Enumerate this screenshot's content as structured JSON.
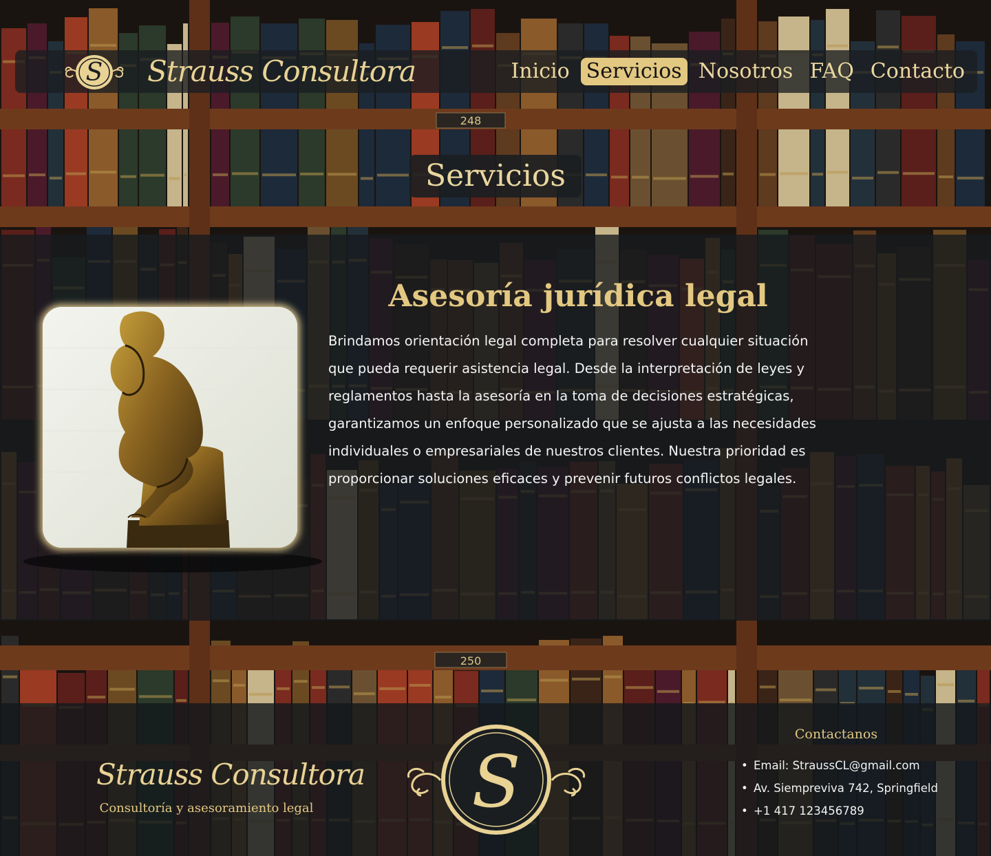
{
  "colors": {
    "accent_gold": "#e3c882",
    "panel_dark": "#1a1e21",
    "text_light": "#f4f4f4"
  },
  "header": {
    "logo_icon": "S-monogram-emblem-icon",
    "logo_letter": "S",
    "brand_name": "Strauss Consultora",
    "nav": [
      {
        "label": "Inicio",
        "active": false
      },
      {
        "label": "Servicios",
        "active": true
      },
      {
        "label": "Nosotros",
        "active": false
      },
      {
        "label": "FAQ",
        "active": false
      },
      {
        "label": "Contacto",
        "active": false
      }
    ]
  },
  "background": {
    "shelf_labels": [
      "248",
      "250"
    ]
  },
  "page": {
    "title": "Servicios"
  },
  "service": {
    "image": "thinker-statue-photo",
    "heading": "Asesoría jurídica legal",
    "description": "Brindamos orientación legal completa para resolver cualquier situación que pueda requerir asistencia legal. Desde la interpretación de leyes y reglamentos hasta la asesoría en la toma de decisiones estratégicas, garantizamos un enfoque personalizado que se ajusta a las necesidades individuales o empresariales de nuestros clientes. Nuestra prioridad es proporcionar soluciones eficaces y prevenir futuros conflictos legales."
  },
  "footer": {
    "brand_name": "Strauss Consultora",
    "tagline": "Consultoría y asesoramiento legal",
    "emblem_icon": "S-monogram-emblem-icon",
    "emblem_letter": "S",
    "contact_heading": "Contactanos",
    "contacts": [
      "Email: StraussCL@gmail.com",
      "Av. Siempreviva 742, Springfield",
      "+1 417 123456789"
    ]
  }
}
